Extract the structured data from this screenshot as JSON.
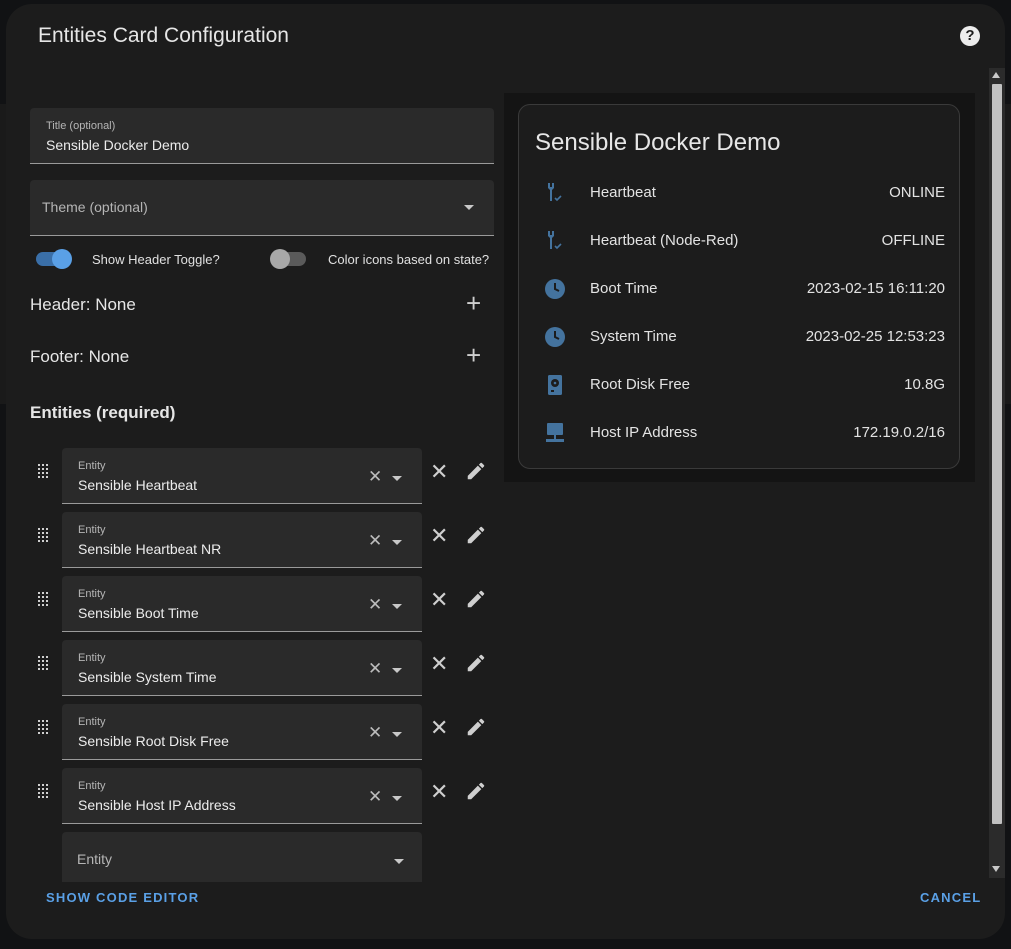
{
  "dialog": {
    "title": "Entities Card Configuration",
    "help_icon": "help-circle-icon"
  },
  "editor": {
    "title_field": {
      "label": "Title (optional)",
      "value": "Sensible Docker Demo"
    },
    "theme_field": {
      "placeholder": "Theme (optional)"
    },
    "toggles": [
      {
        "label": "Show Header Toggle?",
        "on": true
      },
      {
        "label": "Color icons based on state?",
        "on": false
      }
    ],
    "header_row": "Header: None",
    "footer_row": "Footer: None",
    "entities_heading": "Entities (required)",
    "entity_label": "Entity",
    "entities": [
      "Sensible Heartbeat",
      "Sensible Heartbeat NR",
      "Sensible Boot Time",
      "Sensible System Time",
      "Sensible Root Disk Free",
      "Sensible Host IP Address"
    ],
    "new_entity_placeholder": "Entity"
  },
  "preview": {
    "title": "Sensible Docker Demo",
    "rows": [
      {
        "icon": "wrench-check-icon",
        "name": "Heartbeat",
        "state": "ONLINE"
      },
      {
        "icon": "wrench-check-icon",
        "name": "Heartbeat (Node-Red)",
        "state": "OFFLINE"
      },
      {
        "icon": "clock-icon",
        "name": "Boot Time",
        "state": "2023-02-15 16:11:20"
      },
      {
        "icon": "clock-icon",
        "name": "System Time",
        "state": "2023-02-25 12:53:23"
      },
      {
        "icon": "harddisk-icon",
        "name": "Root Disk Free",
        "state": "10.8G"
      },
      {
        "icon": "lan-icon",
        "name": "Host IP Address",
        "state": "172.19.0.2/16"
      }
    ]
  },
  "footer": {
    "show_code_editor": "SHOW CODE EDITOR",
    "cancel": "CANCEL"
  },
  "colors": {
    "accent": "#5aa0e6",
    "icon_state": "#44739e",
    "toggle_on_track": "#3a6fa8",
    "toggle_on_thumb": "#5aa0e6"
  }
}
